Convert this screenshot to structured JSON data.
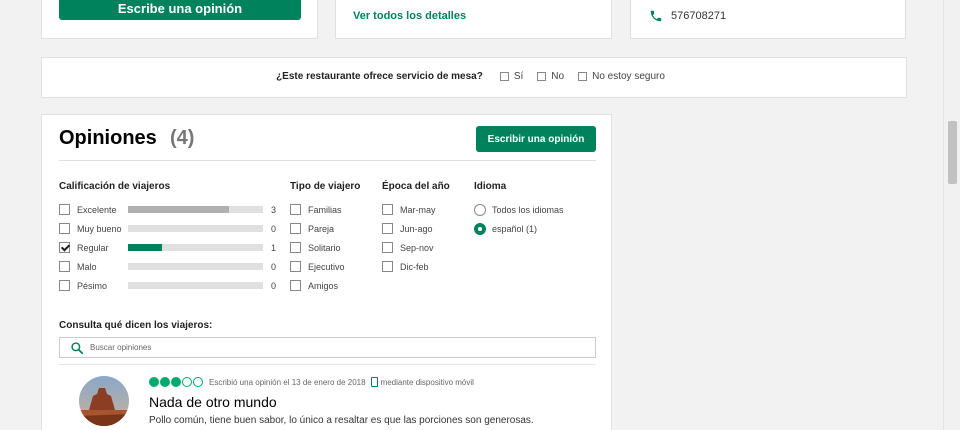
{
  "top": {
    "write_review_label": "Escribe una opinión",
    "details_link": "Ver todos los detalles",
    "phone": "576708271"
  },
  "mesa": {
    "question": "¿Este restaurante ofrece servicio de mesa?",
    "options": [
      "Sí",
      "No",
      "No estoy seguro"
    ]
  },
  "reviews": {
    "title": "Opiniones",
    "count": "(4)",
    "write_button": "Escribir una opinión",
    "rating": {
      "heading": "Calificación de viajeros",
      "items": [
        {
          "label": "Excelente",
          "count": "3",
          "fraction": 0.75,
          "checked": false
        },
        {
          "label": "Muy bueno",
          "count": "0",
          "fraction": 0,
          "checked": false
        },
        {
          "label": "Regular",
          "count": "1",
          "fraction": 0.25,
          "checked": true
        },
        {
          "label": "Malo",
          "count": "0",
          "fraction": 0,
          "checked": false
        },
        {
          "label": "Pésimo",
          "count": "0",
          "fraction": 0,
          "checked": false
        }
      ]
    },
    "traveler_type": {
      "heading": "Tipo de viajero",
      "items": [
        "Familias",
        "Pareja",
        "Solitario",
        "Ejecutivo",
        "Amigos"
      ]
    },
    "season": {
      "heading": "Época del año",
      "items": [
        "Mar-may",
        "Jun-ago",
        "Sep-nov",
        "Dic-feb"
      ]
    },
    "language": {
      "heading": "Idioma",
      "items": [
        {
          "label": "Todos los idiomas",
          "selected": false
        },
        {
          "label": "español",
          "count": "(1)",
          "selected": true
        }
      ]
    },
    "consulta": "Consulta qué dicen los viajeros:",
    "search_placeholder": "Buscar opiniones",
    "first_review": {
      "bubble_rating": 3,
      "meta": "Escribió una opinión el 13 de enero de 2018",
      "device": "mediante dispositivo móvil",
      "title": "Nada de otro mundo",
      "body": "Pollo común, tiene buen sabor, lo único a resaltar es que las porciones son generosas."
    }
  },
  "colors": {
    "brand_green": "#00825c",
    "bubble_green": "#00aa6c",
    "bar_full": "#b0b0b0",
    "bar_selected": "#00825c"
  }
}
